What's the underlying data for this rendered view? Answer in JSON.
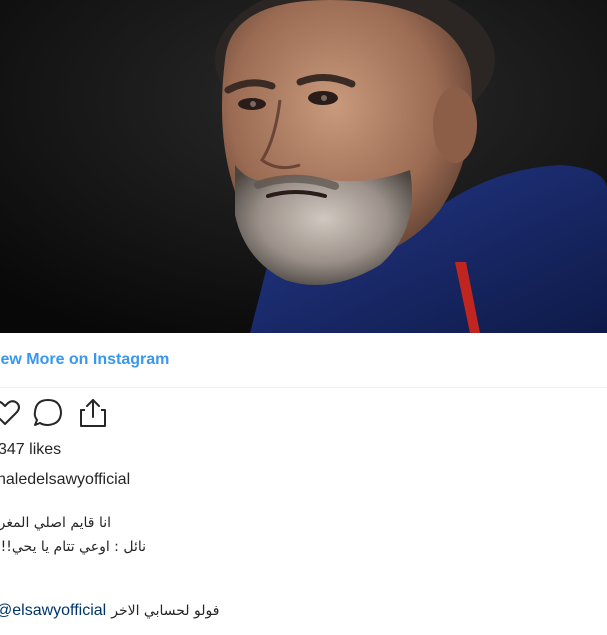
{
  "post": {
    "image_alt": "Portrait of a bearded man in a dark blue jacket against a dark background",
    "view_more_label": "iew More on Instagram",
    "likes_label": "347 likes",
    "username": "haledelsawyofficial",
    "caption_line_1": "انا قايم اصلي المغر",
    "caption_line_2": "!!!!نائل : اوعي تتام يا يحي",
    "mention": "elsawyofficial",
    "follow_text": "فولو لحسابي الاخر"
  },
  "icons": {
    "like": "heart-icon",
    "comment": "comment-icon",
    "share": "share-icon"
  },
  "colors": {
    "link": "#3897f0",
    "text": "#262626",
    "mention": "#003569",
    "divider": "#efefef",
    "jacket": "#1b2c6b",
    "jacket_trim": "#c0261f"
  }
}
